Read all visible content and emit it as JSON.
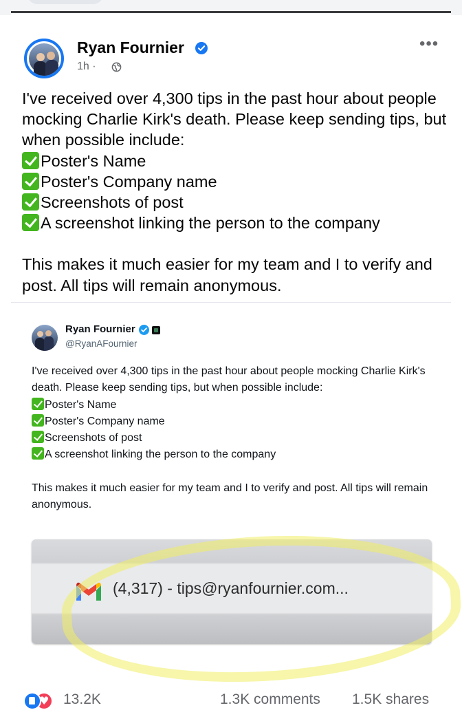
{
  "post": {
    "author": "Ryan Fournier",
    "time": "1h",
    "separator": "·",
    "more": "•••",
    "intro": "I've received over 4,300 tips in the past hour about people mocking Charlie Kirk's death. Please keep sending tips, but when possible include:",
    "items": [
      "Poster's Name",
      "Poster's Company name",
      "Screenshots of post",
      "A screenshot linking the person to the company"
    ],
    "closing": "This makes it much easier for my team and I to verify and post. All tips will remain anonymous."
  },
  "tweet": {
    "name": "Ryan Fournier",
    "handle": "@RyanAFournier",
    "intro": "I've received over 4,300 tips in the past hour about people mocking Charlie Kirk's death. Please keep sending tips, but when possible include:",
    "items": [
      "Poster's Name",
      "Poster's Company name",
      "Screenshots of post",
      "A screenshot linking the person to the company"
    ],
    "closing": "This makes it much easier for my team and I to verify and post. All tips will remain anonymous."
  },
  "notification": {
    "text": "(4,317) - tips@ryanfournier.com..."
  },
  "footer": {
    "reactions": "13.2K",
    "comments": "1.3K comments",
    "shares": "1.5K shares"
  },
  "colors": {
    "accent": "#1877f2",
    "check": "#43b51e",
    "love": "#f33e58",
    "highlight": "#f0ee64"
  }
}
